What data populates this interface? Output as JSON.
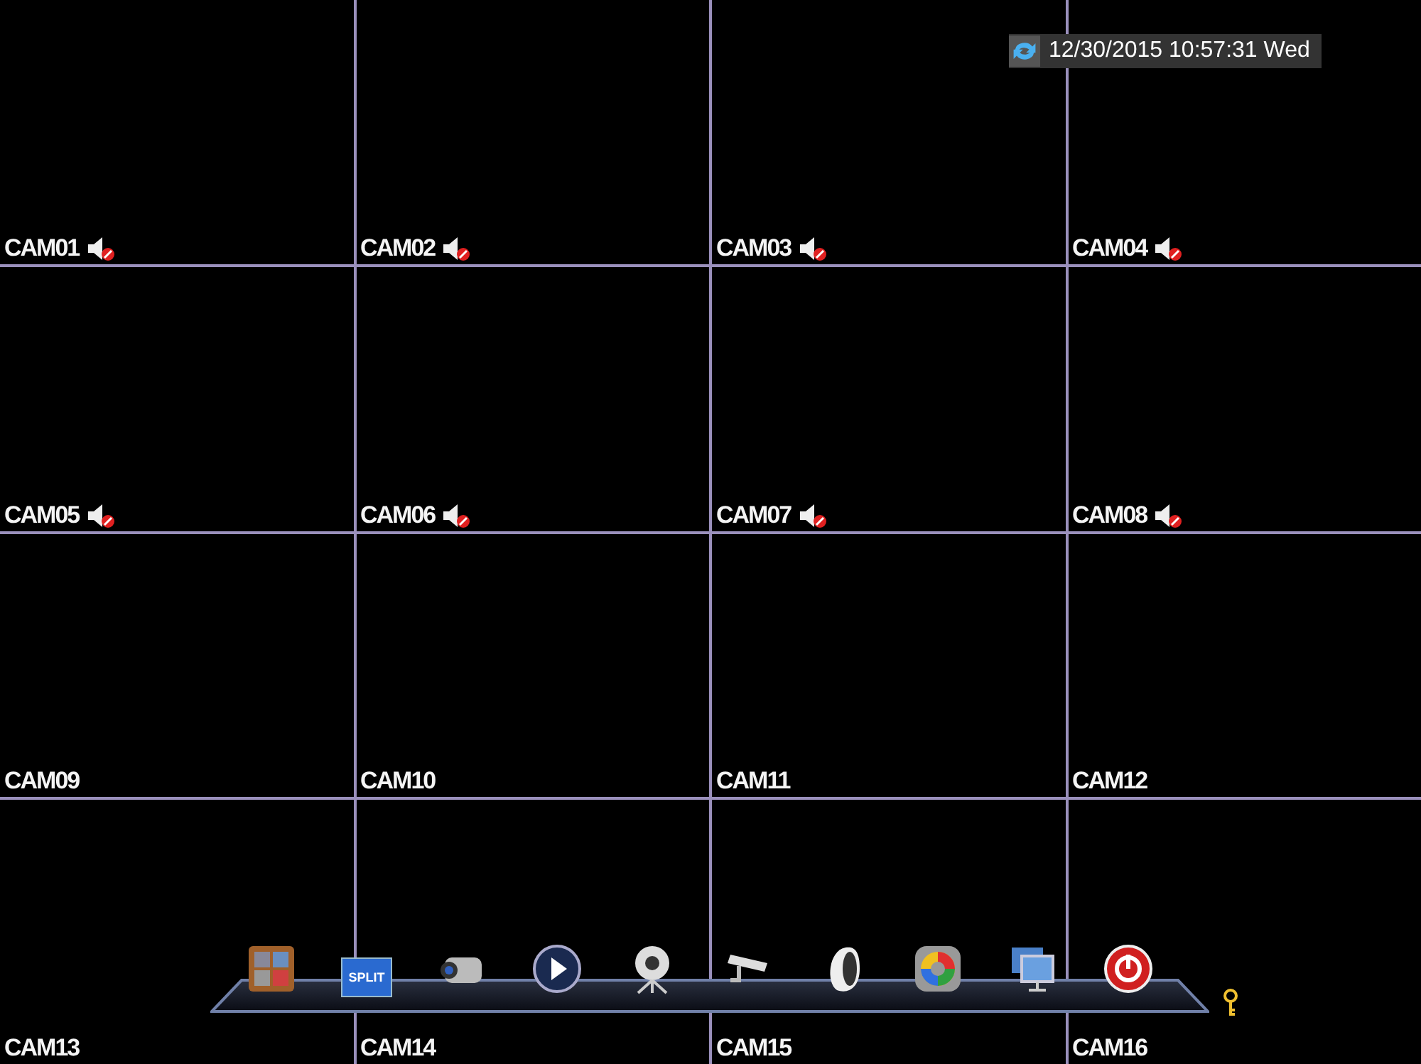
{
  "datetime": {
    "text": "12/30/2015 10:57:31 Wed"
  },
  "cameras": [
    {
      "label": "CAM01",
      "muted": true
    },
    {
      "label": "CAM02",
      "muted": true
    },
    {
      "label": "CAM03",
      "muted": true
    },
    {
      "label": "CAM04",
      "muted": true
    },
    {
      "label": "CAM05",
      "muted": true
    },
    {
      "label": "CAM06",
      "muted": true
    },
    {
      "label": "CAM07",
      "muted": true
    },
    {
      "label": "CAM08",
      "muted": true
    },
    {
      "label": "CAM09",
      "muted": false
    },
    {
      "label": "CAM10",
      "muted": false
    },
    {
      "label": "CAM11",
      "muted": false
    },
    {
      "label": "CAM12",
      "muted": false
    },
    {
      "label": "CAM13",
      "muted": false
    },
    {
      "label": "CAM14",
      "muted": false
    },
    {
      "label": "CAM15",
      "muted": false
    },
    {
      "label": "CAM16",
      "muted": false
    }
  ],
  "dock": [
    {
      "kind": "menu"
    },
    {
      "kind": "split",
      "text": "SPLIT"
    },
    {
      "kind": "camcorder"
    },
    {
      "kind": "play"
    },
    {
      "kind": "webcam"
    },
    {
      "kind": "cctv"
    },
    {
      "kind": "bell"
    },
    {
      "kind": "wheel"
    },
    {
      "kind": "monitor"
    },
    {
      "kind": "power"
    }
  ]
}
